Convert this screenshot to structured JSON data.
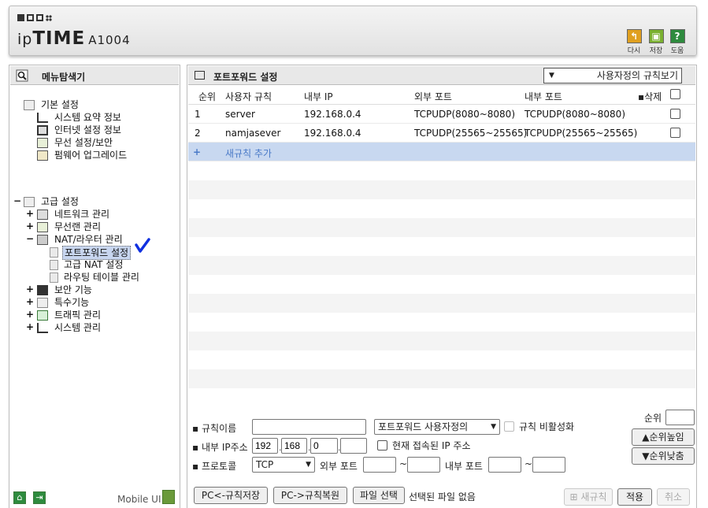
{
  "header": {
    "brand_ip": "ip",
    "brand_time": "TIME",
    "model": "A1004",
    "buttons": [
      {
        "icon": "reload-icon",
        "label": "다시",
        "color": "#e0a020"
      },
      {
        "icon": "save-icon",
        "label": "저장",
        "color": "#7ab030"
      },
      {
        "icon": "help-icon",
        "label": "도움",
        "color": "#2e8b3e"
      }
    ]
  },
  "sidebar": {
    "title": "메뉴탐색기",
    "basic": {
      "label": "기본 설정",
      "expander": "",
      "items": [
        {
          "label": "시스템 요약 정보",
          "icon": "chart-icon"
        },
        {
          "label": "인터넷 설정 정보",
          "icon": "monitor-icon"
        },
        {
          "label": "무선 설정/보안",
          "icon": "wireless-icon"
        },
        {
          "label": "펌웨어 업그레이드",
          "icon": "upgrade-icon"
        }
      ]
    },
    "advanced": {
      "label": "고급 설정",
      "expander": "−",
      "groups": [
        {
          "label": "네트워크 관리",
          "expander": "+",
          "icon": "network-icon"
        },
        {
          "label": "무선랜 관리",
          "expander": "+",
          "icon": "wireless-icon"
        },
        {
          "label": "NAT/라우터 관리",
          "expander": "−",
          "icon": "router-icon",
          "children": [
            {
              "label": "포트포워드 설정",
              "selected": true
            },
            {
              "label": "고급 NAT 설정",
              "selected": false
            },
            {
              "label": "라우팅 테이블 관리",
              "selected": false
            }
          ]
        },
        {
          "label": "보안 기능",
          "expander": "+",
          "icon": "lock-icon"
        },
        {
          "label": "특수기능",
          "expander": "+",
          "icon": "special-icon"
        },
        {
          "label": "트래픽 관리",
          "expander": "+",
          "icon": "traffic-icon"
        },
        {
          "label": "시스템 관리",
          "expander": "+",
          "icon": "chart-icon"
        }
      ]
    },
    "footer": {
      "home_icon": "home-icon",
      "logout_icon": "logout-icon",
      "mobile_label": "Mobile UI",
      "mobile_icon": "mobile-icon"
    }
  },
  "main": {
    "title": "포트포워드 설정",
    "view_select": "사용자정의 규칙보기",
    "table": {
      "headers": {
        "rank": "순위",
        "rule": "사용자 규칙",
        "internal_ip": "내부 IP",
        "external_port": "외부 포트",
        "internal_port": "내부 포트",
        "delete": "▪삭제"
      },
      "rows": [
        {
          "rank": "1",
          "rule": "server",
          "internal_ip": "192.168.0.4",
          "external_port": "TCPUDP(8080~8080)",
          "internal_port": "TCPUDP(8080~8080)"
        },
        {
          "rank": "2",
          "rule": "namjasever",
          "internal_ip": "192.168.0.4",
          "external_port": "TCPUDP(25565~25565)",
          "internal_port": "TCPUDP(25565~25565)"
        }
      ],
      "add_row": {
        "plus": "+",
        "label": "새규칙 추가"
      }
    },
    "form": {
      "rule_name_label": "▪ 규칙이름",
      "rule_name_value": "",
      "type_select": "포트포워드 사용자정의",
      "disable_label": "규칙 비활성화",
      "internal_ip_label": "▪ 내부 IP주소",
      "ip": [
        "192",
        "168",
        "0",
        ""
      ],
      "current_ip_label": "현재 접속된 IP 주소",
      "protocol_label": "▪ 프로토콜",
      "protocol_value": "TCP",
      "external_port_label": "외부 포트",
      "internal_port_label": "내부 포트",
      "tilde": "~",
      "rank_label": "순위",
      "rank_up": "▲순위높임",
      "rank_down": "▼순위낮춤"
    },
    "bottom": {
      "backup": "PC<-규칙저장",
      "restore": "PC->규칙복원",
      "file_select": "파일 선택",
      "file_status": "선택된 파일 없음",
      "new_rule": "새규칙",
      "apply": "적용",
      "cancel": "취소"
    }
  }
}
